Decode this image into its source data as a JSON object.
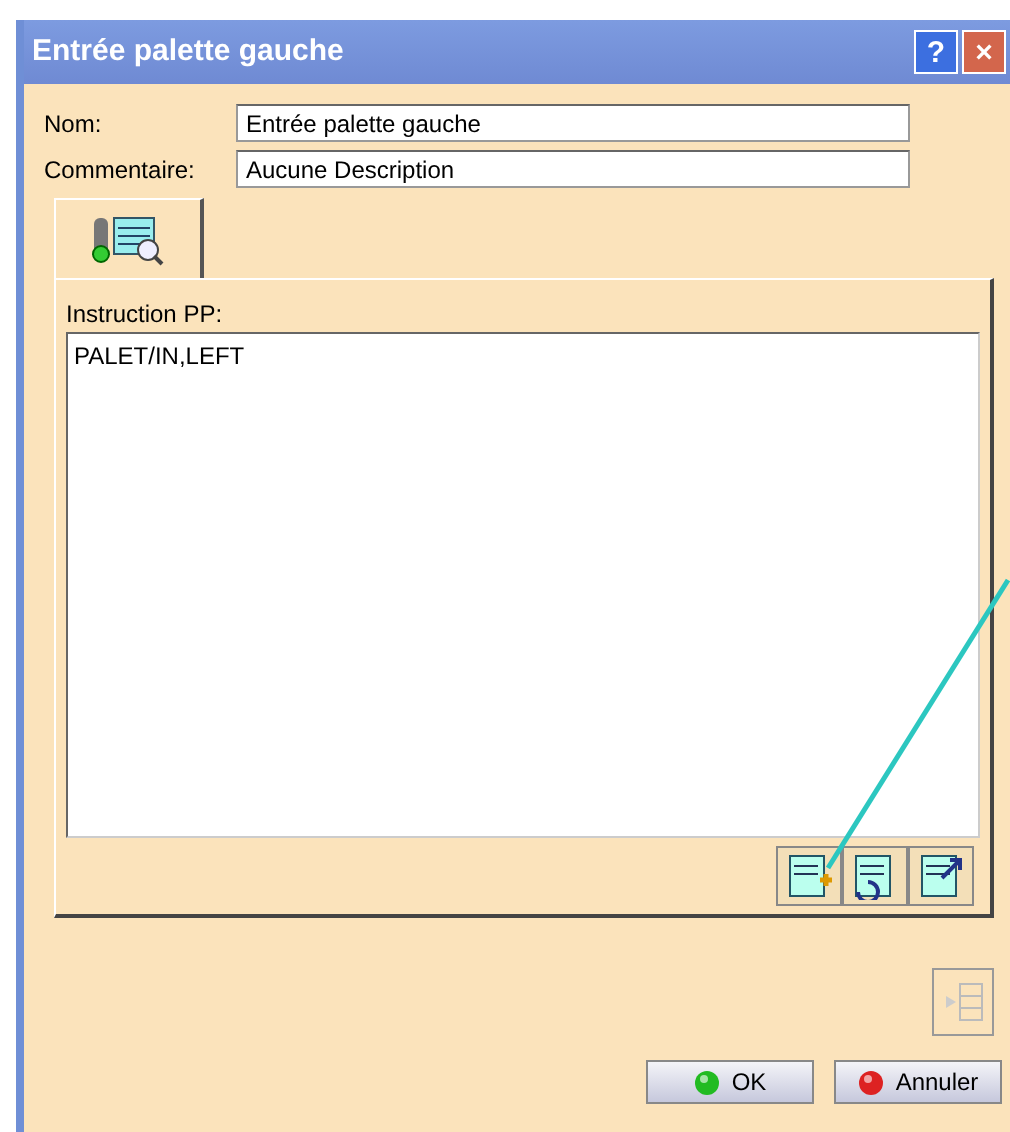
{
  "window": {
    "title": "Entrée palette gauche",
    "title_buttons": [
      "?",
      "×"
    ]
  },
  "fields": [
    {
      "label": "Nom:",
      "value": "Entrée palette gauche"
    },
    {
      "label": "Commentaire:",
      "value": "Aucune Description"
    }
  ],
  "tabs": [
    {
      "selected": true
    }
  ],
  "instruction": {
    "label": "Instruction PP:",
    "value": "PALET/IN,LEFT"
  },
  "buttons": [
    {
      "label": "OK",
      "kind": "ok"
    },
    {
      "label": "Annuler",
      "kind": "cancel"
    }
  ]
}
